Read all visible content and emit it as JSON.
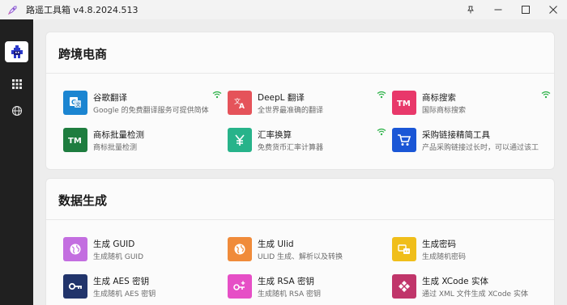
{
  "window": {
    "title": "路遥工具箱 v4.8.2024.513",
    "buttons": [
      "pin-icon",
      "minimize-icon",
      "maximize-icon",
      "close-icon"
    ]
  },
  "sidebar": {
    "items": [
      {
        "icon": "app-avatar-icon",
        "active": true
      },
      {
        "icon": "grid-icon",
        "active": false
      },
      {
        "icon": "globe-icon",
        "active": false
      }
    ]
  },
  "sections": [
    {
      "title": "跨境电商",
      "tools": [
        {
          "name": "谷歌翻译",
          "desc": "Google 的免费翻译服务可提供简体",
          "icon": "google-translate-icon",
          "color": "#1b85d1",
          "online": true
        },
        {
          "name": "DeepL 翻译",
          "desc": "全世界最准确的翻译",
          "icon": "translate-icon",
          "color": "#e5535a",
          "online": true
        },
        {
          "name": "商标搜索",
          "desc": "国际商标搜索",
          "icon": "tm-icon",
          "color": "#e8386a",
          "online": true
        },
        {
          "name": "商标批量检测",
          "desc": "商标批量检测",
          "icon": "tm-icon",
          "color": "#1e7d3f",
          "online": false
        },
        {
          "name": "汇率换算",
          "desc": "免费货币汇率计算器",
          "icon": "yen-icon",
          "color": "#27b38a",
          "online": true
        },
        {
          "name": "采购链接精简工具",
          "desc": "产品采购链接过长时，可以通过该工",
          "icon": "cart-icon",
          "color": "#1a56d6",
          "online": false
        }
      ]
    },
    {
      "title": "数据生成",
      "tools": [
        {
          "name": "生成 GUID",
          "desc": "生成随机 GUID",
          "icon": "globe-icon",
          "color": "#c36ee0",
          "online": false
        },
        {
          "name": "生成 Ulid",
          "desc": "ULID 生成、解析以及转换",
          "icon": "globe-icon",
          "color": "#f08b3a",
          "online": false
        },
        {
          "name": "生成密码",
          "desc": "生成随机密码",
          "icon": "password-icon",
          "color": "#f0be1a",
          "online": false
        },
        {
          "name": "生成 AES 密钥",
          "desc": "生成随机 AES 密钥",
          "icon": "key-icon",
          "color": "#21346b",
          "online": false
        },
        {
          "name": "生成 RSA 密钥",
          "desc": "生成随机 RSA 密钥",
          "icon": "key-plus-icon",
          "color": "#e64fc6",
          "online": false
        },
        {
          "name": "生成 XCode 实体",
          "desc": "通过 XML 文件生成 XCode 实体",
          "icon": "diamond-icon",
          "color": "#c0356a",
          "online": false
        }
      ]
    }
  ]
}
